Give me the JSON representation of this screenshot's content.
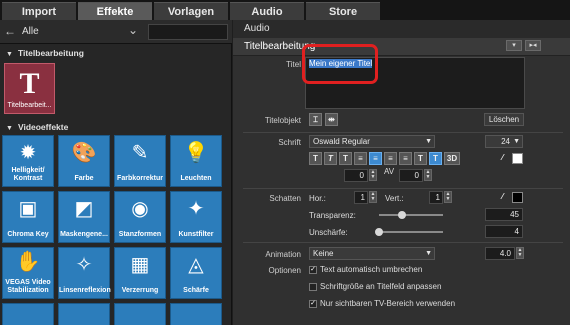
{
  "tabs": [
    {
      "label": "Import"
    },
    {
      "label": "Effekte"
    },
    {
      "label": "Vorlagen"
    },
    {
      "label": "Audio"
    },
    {
      "label": "Store"
    }
  ],
  "left": {
    "nav_label": "Alle",
    "section_title": "Titelbearbeitung",
    "title_tile": "Titelbearbeit...",
    "section_video": "Videoeffekte",
    "effects": [
      {
        "label": "Helligkeit/ Kontrast",
        "icon": "sun-icon"
      },
      {
        "label": "Farbe",
        "icon": "palette-icon"
      },
      {
        "label": "Farbkorrektur",
        "icon": "color-correction-icon"
      },
      {
        "label": "Leuchten",
        "icon": "bulb-icon"
      },
      {
        "label": "Chroma Key",
        "icon": "chroma-key-icon"
      },
      {
        "label": "Maskengene...",
        "icon": "mask-icon"
      },
      {
        "label": "Stanzformen",
        "icon": "shapes-icon"
      },
      {
        "label": "Kunstfilter",
        "icon": "art-filter-icon"
      },
      {
        "label": "VEGAS Video Stabilization",
        "icon": "hand-icon"
      },
      {
        "label": "Linsenreflexion",
        "icon": "lens-flare-icon"
      },
      {
        "label": "Verzerrung",
        "icon": "distortion-icon"
      },
      {
        "label": "Schärfe",
        "icon": "sharpness-icon"
      }
    ]
  },
  "right": {
    "audio_header": "Audio",
    "title_header": "Titelbearbeitung",
    "titel_label": "Titel",
    "titel_value": "Mein eigener Titel",
    "titelobjekt_label": "Titelobjekt",
    "loeschen": "Löschen",
    "schrift_label": "Schrift",
    "font_name": "Oswald Regular",
    "font_size": "24",
    "char_spacing": "0",
    "line_spacing": "0",
    "schatten_label": "Schatten",
    "hor_label": "Hor.:",
    "hor_value": "1",
    "vert_label": "Vert.:",
    "vert_value": "1",
    "transparenz_label": "Transparenz:",
    "transparenz_value": "45",
    "unschaerfe_label": "Unschärfe:",
    "unschaerfe_value": "4",
    "animation_label": "Animation",
    "animation_value": "Keine",
    "animation_speed": "4.0",
    "optionen_label": "Optionen",
    "options": [
      {
        "label": "Text automatisch umbrechen",
        "checked": true
      },
      {
        "label": "Schriftgröße an Titelfeld anpassen",
        "checked": false
      },
      {
        "label": "Nur sichtbaren TV-Bereich verwenden",
        "checked": true
      }
    ]
  }
}
